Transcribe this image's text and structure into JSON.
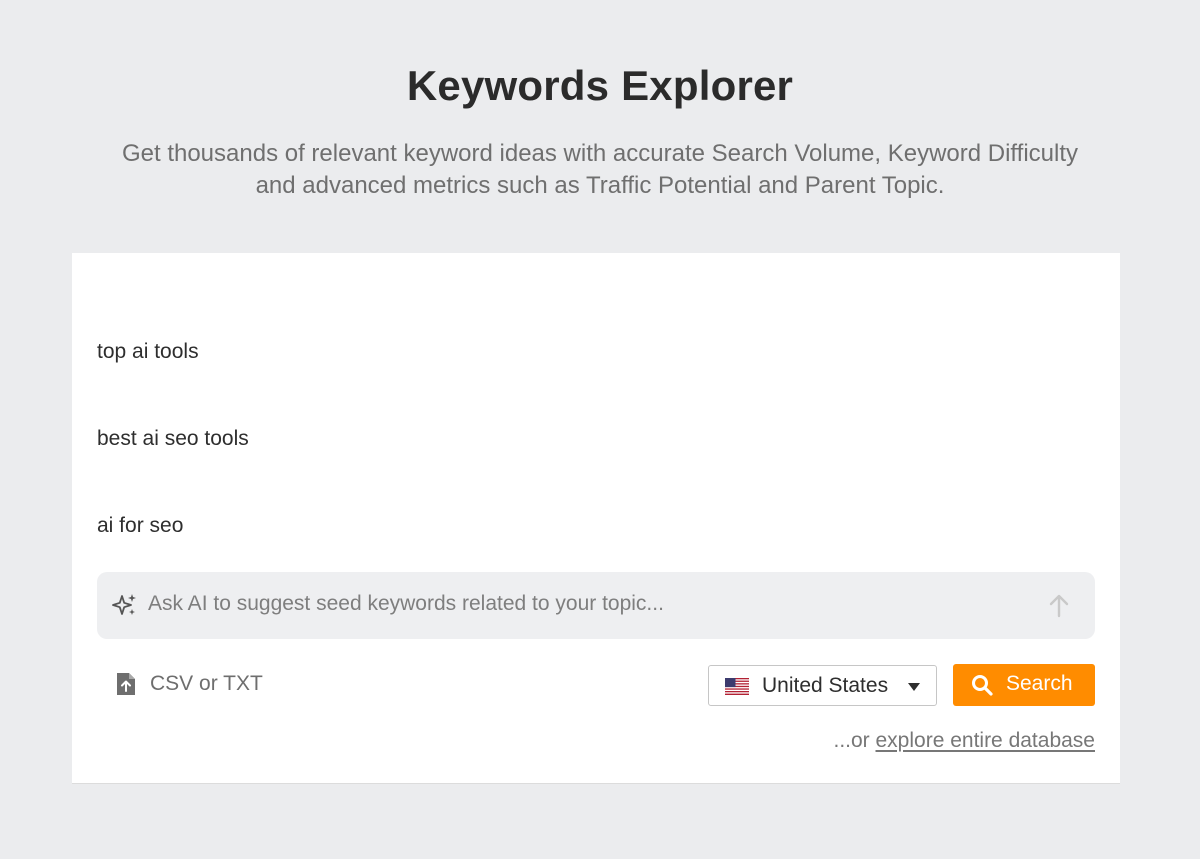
{
  "header": {
    "title": "Keywords Explorer",
    "subtitle": "Get thousands of relevant keyword ideas with accurate Search Volume, Keyword Difficulty and advanced metrics such as Traffic Potential and Parent Topic."
  },
  "keywords_input": {
    "lines": [
      "top ai tools",
      "best ai seo tools",
      "ai for seo"
    ]
  },
  "ai_prompt": {
    "placeholder": "Ask AI to suggest seed keywords related to your topic...",
    "icon": "sparkle-icon",
    "submit_icon": "arrow-up-icon"
  },
  "upload": {
    "label": "CSV or TXT",
    "icon": "file-upload-icon"
  },
  "country_select": {
    "selected": "United States",
    "flag": "us-flag-icon"
  },
  "search_button": {
    "label": "Search",
    "color": "#ff8c00"
  },
  "explore": {
    "prefix": "...or ",
    "link": "explore entire database"
  }
}
